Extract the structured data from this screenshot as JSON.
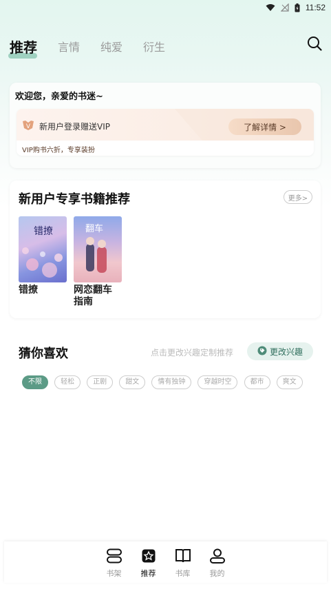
{
  "status_bar": {
    "time": "11:52"
  },
  "top_tabs": [
    {
      "label": "推荐",
      "active": true
    },
    {
      "label": "言情",
      "active": false
    },
    {
      "label": "纯爱",
      "active": false
    },
    {
      "label": "衍生",
      "active": false
    }
  ],
  "welcome": {
    "title": "欢迎您，亲爱的书迷~",
    "vip_badge": "V",
    "vip_text": "新用户登录赠送VIP",
    "vip_button": "了解详情 >",
    "vip_sub": "VIP购书六折，专享装扮"
  },
  "new_user_books": {
    "title": "新用户专享书籍推荐",
    "more_label": "更多>",
    "books": [
      {
        "title": "错撩",
        "cover_text": "错撩"
      },
      {
        "title": "网恋翻车指南",
        "cover_text": "翻车"
      }
    ]
  },
  "guess": {
    "title": "猜你喜欢",
    "hint": "点击更改兴趣定制推荐",
    "button": "更改兴趣",
    "chips": [
      {
        "label": "不限",
        "active": true
      },
      {
        "label": "轻松",
        "active": false
      },
      {
        "label": "正剧",
        "active": false
      },
      {
        "label": "甜文",
        "active": false
      },
      {
        "label": "情有独钟",
        "active": false
      },
      {
        "label": "穿越时空",
        "active": false
      },
      {
        "label": "都市",
        "active": false
      },
      {
        "label": "爽文",
        "active": false
      }
    ]
  },
  "bottom_nav": [
    {
      "label": "书架",
      "icon": "bookshelf-icon",
      "active": false
    },
    {
      "label": "推荐",
      "icon": "recommend-icon",
      "active": true
    },
    {
      "label": "书库",
      "icon": "library-icon",
      "active": false
    },
    {
      "label": "我的",
      "icon": "profile-icon",
      "active": false
    }
  ],
  "colors": {
    "accent": "#5c9b86",
    "vip": "#d9916b"
  }
}
